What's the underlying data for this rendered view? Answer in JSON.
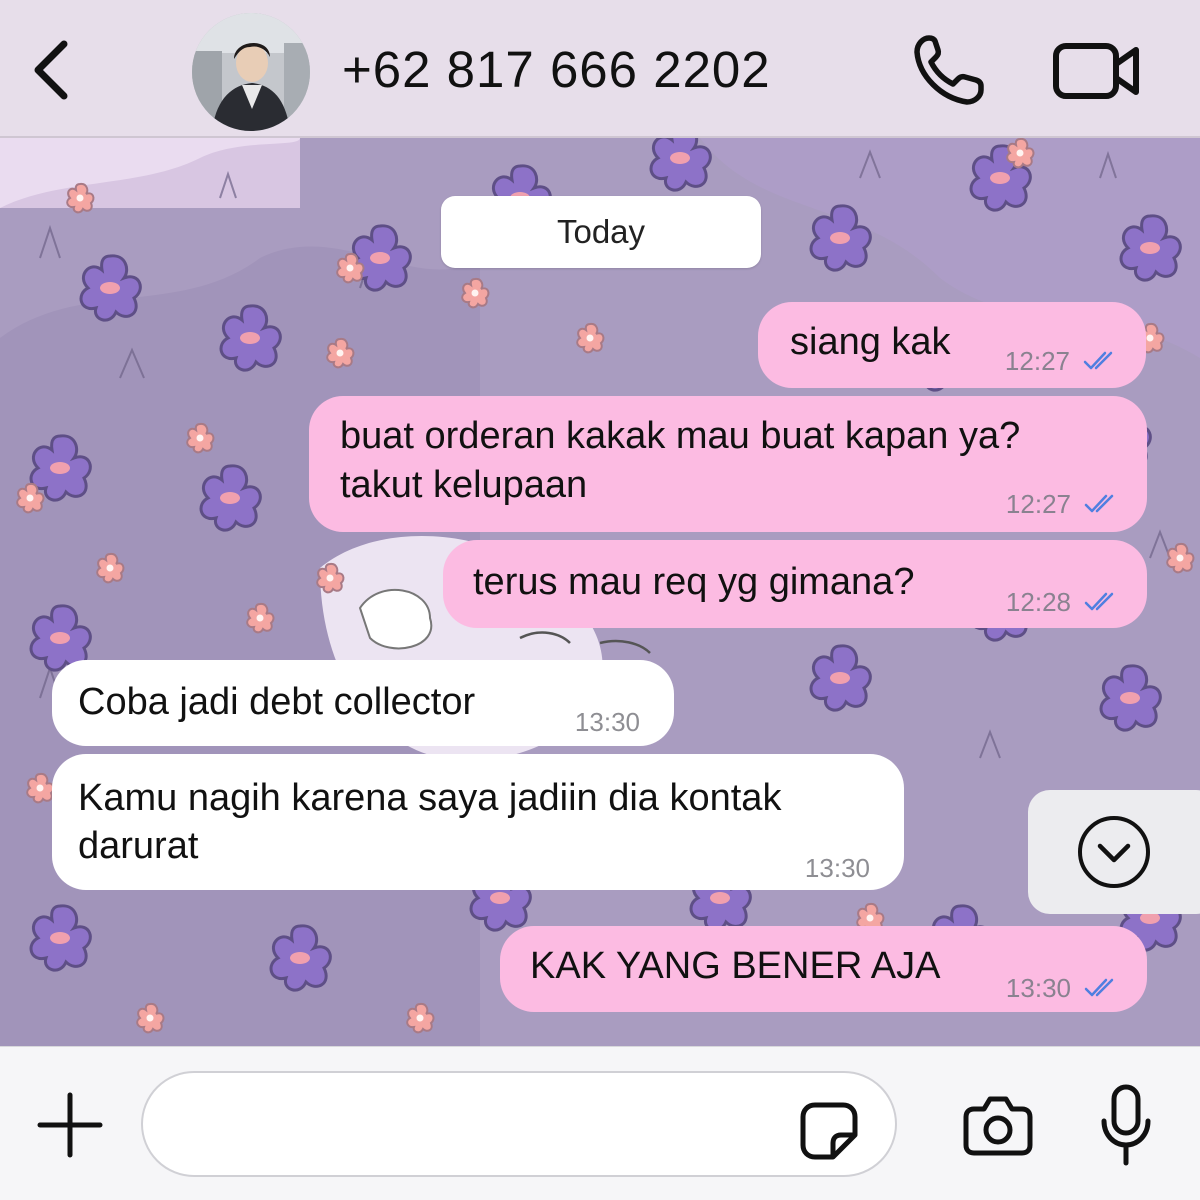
{
  "header": {
    "contact_name": "+62 817 666 2202",
    "back_icon": "chevron-left-icon",
    "call_icon": "phone-icon",
    "video_icon": "video-camera-icon",
    "avatar_description": "avatar"
  },
  "chat": {
    "date_label": "Today",
    "messages": [
      {
        "direction": "outgoing",
        "text": "siang kak",
        "time": "12:27",
        "status": "read"
      },
      {
        "direction": "outgoing",
        "lines": [
          "buat orderan kakak mau buat kapan ya?",
          "takut kelupaan"
        ],
        "time": "12:27",
        "status": "read"
      },
      {
        "direction": "outgoing",
        "text": "terus mau req yg gimana?",
        "time": "12:28",
        "status": "read"
      },
      {
        "direction": "incoming",
        "text": "Coba jadi debt collector",
        "time": "13:30"
      },
      {
        "direction": "incoming",
        "lines": [
          "Kamu nagih karena saya jadiin dia kontak",
          "darurat"
        ],
        "time": "13:30"
      },
      {
        "direction": "outgoing",
        "text": "KAK YANG BENER AJA",
        "time": "13:30",
        "status": "read"
      }
    ],
    "scroll_down_icon": "chevron-down-circle-icon"
  },
  "input_bar": {
    "placeholder": "",
    "value": "",
    "plus_icon": "plus-icon",
    "sticker_icon": "sticker-icon",
    "camera_icon": "camera-icon",
    "mic_icon": "microphone-icon"
  },
  "colors": {
    "header_bg": "#e7deea",
    "outgoing_bubble": "#fcbbe2",
    "incoming_bubble": "#ffffff",
    "read_ticks": "#4f7fe0",
    "wallpaper_base": "#a99cc0"
  }
}
